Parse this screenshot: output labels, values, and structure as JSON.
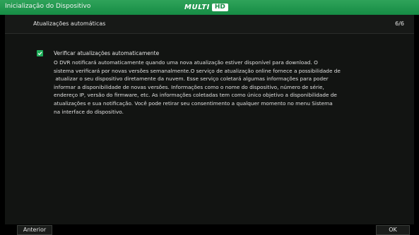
{
  "window": {
    "title": "Inicialização do Dispositivo"
  },
  "brand": {
    "text": "MULTI",
    "badge": "HD"
  },
  "header": {
    "title": "Atualizações automáticas",
    "step": "6/6"
  },
  "auto_update": {
    "checked": true,
    "label": "Verificar atualizações automaticamente"
  },
  "description": {
    "lines": [
      "O DVR notificará automaticamente quando uma nova atualização estiver disponível para download. O",
      "sistema verificará por novas versões semanalmente.O serviço de atualização online fornece a possibilidade de",
      " atualizar o seu dispositivo diretamente da nuvem. Esse serviço coletará algumas informações para poder",
      "informar a disponibilidade de novas versões. Informações como o nome do dispositivo, número de série,",
      "endereço IP, versão do firmware, etc. As informações coletadas tem como único objetivo a disponibilidade de",
      "atualizações e sua notificação. Você pode retirar seu consentimento a qualquer momento no menu Sistema",
      "na interface do dispositivo."
    ]
  },
  "buttons": {
    "previous": "Anterior",
    "ok": "OK"
  },
  "colors": {
    "accent": "#1fae5a",
    "titlebar": "#168c45",
    "panel": "#121412"
  }
}
